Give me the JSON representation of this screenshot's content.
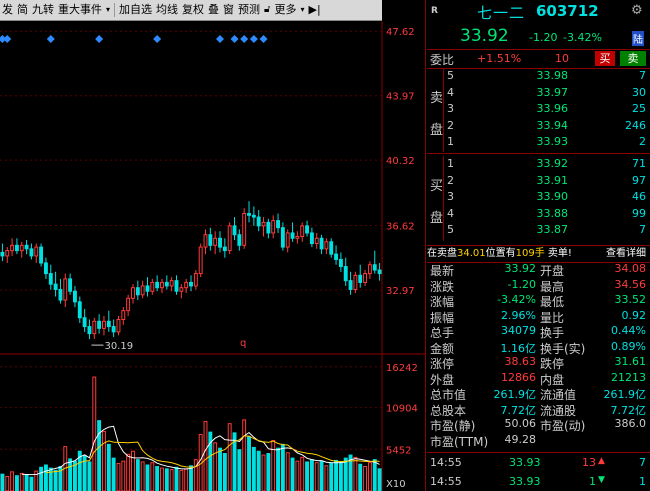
{
  "toolbar": {
    "items": [
      "发",
      "简",
      "九转",
      "重大事件",
      "加自选",
      "均线",
      "复权",
      "叠",
      "窗",
      "预测",
      "更多"
    ],
    "menu_arrow_label": "▾",
    "lock_icon": "lock-icon",
    "more_arrow": "▾",
    "export_label": "▶|"
  },
  "stock": {
    "name": "七一二",
    "code": "603712",
    "price": "33.92",
    "change": "-1.20",
    "change_pct": "-3.42%",
    "market_badge": "陆",
    "r_label": "R"
  },
  "ratio": {
    "label": "委比",
    "value": "+1.51%",
    "diff": "10",
    "buy_btn": "买",
    "sell_btn": "卖"
  },
  "sell_side_label": [
    "卖",
    "盘"
  ],
  "buy_side_label": [
    "买",
    "盘"
  ],
  "asks": [
    {
      "level": "5",
      "price": "33.98",
      "vol": "7"
    },
    {
      "level": "4",
      "price": "33.97",
      "vol": "30"
    },
    {
      "level": "3",
      "price": "33.96",
      "vol": "25"
    },
    {
      "level": "2",
      "price": "33.94",
      "vol": "246"
    },
    {
      "level": "1",
      "price": "33.93",
      "vol": "2"
    }
  ],
  "bids": [
    {
      "level": "1",
      "price": "33.92",
      "vol": "71"
    },
    {
      "level": "2",
      "price": "33.91",
      "vol": "97"
    },
    {
      "level": "3",
      "price": "33.90",
      "vol": "46"
    },
    {
      "level": "4",
      "price": "33.88",
      "vol": "99"
    },
    {
      "level": "5",
      "price": "33.87",
      "vol": "7"
    }
  ],
  "notice": {
    "prefix": "在卖盘",
    "price": "34.01",
    "mid": "位置有",
    "qty": "109手",
    "action": "卖单!",
    "link": "查看详细"
  },
  "stats": [
    {
      "k1": "最新",
      "v1": "33.92",
      "c1": "#00e676",
      "k2": "开盘",
      "v2": "34.08",
      "c2": "#ff3b3b"
    },
    {
      "k1": "涨跌",
      "v1": "-1.20",
      "c1": "#00e676",
      "k2": "最高",
      "v2": "34.56",
      "c2": "#ff3b3b"
    },
    {
      "k1": "涨幅",
      "v1": "-3.42%",
      "c1": "#00e676",
      "k2": "最低",
      "v2": "33.52",
      "c2": "#00e676"
    },
    {
      "k1": "振幅",
      "v1": "2.96%",
      "c1": "#00e0e0",
      "k2": "量比",
      "v2": "0.92",
      "c2": "#00e0e0"
    },
    {
      "k1": "总手",
      "v1": "34079",
      "c1": "#00e0e0",
      "k2": "换手",
      "v2": "0.44%",
      "c2": "#00e0e0"
    },
    {
      "k1": "金额",
      "v1": "1.16亿",
      "c1": "#00e0e0",
      "k2": "换手(实)",
      "v2": "0.89%",
      "c2": "#00e0e0"
    },
    {
      "k1": "涨停",
      "v1": "38.63",
      "c1": "#ff3b3b",
      "k2": "跌停",
      "v2": "31.61",
      "c2": "#00e676"
    },
    {
      "k1": "外盘",
      "v1": "12866",
      "c1": "#ff3b3b",
      "k2": "内盘",
      "v2": "21213",
      "c2": "#00e676"
    },
    {
      "k1": "总市值",
      "v1": "261.9亿",
      "c1": "#00e0e0",
      "k2": "流通值",
      "v2": "261.9亿",
      "c2": "#00e0e0"
    },
    {
      "k1": "总股本",
      "v1": "7.72亿",
      "c1": "#00e0e0",
      "k2": "流通股",
      "v2": "7.72亿",
      "c2": "#00e0e0"
    },
    {
      "k1": "市盈(静)",
      "v1": "50.06",
      "c1": "#ccc",
      "k2": "市盈(动)",
      "v2": "386.0",
      "c2": "#ccc"
    },
    {
      "k1": "市盈(TTM)",
      "v1": "49.28",
      "c1": "#ccc",
      "k2": "",
      "v2": "",
      "c2": "#ccc"
    }
  ],
  "ticks": [
    {
      "time": "14:55",
      "price": "33.93",
      "vol": "13",
      "dir": "up",
      "count": "7"
    },
    {
      "time": "14:55",
      "price": "33.93",
      "vol": "1",
      "dir": "down",
      "count": "1"
    }
  ],
  "colors": {
    "up": "#ff3b3b",
    "down": "#00e0e0",
    "border": "#8b0000",
    "axis_text": "#ff3b3b"
  },
  "chart_data": {
    "type": "candlestick",
    "price_axis_ticks": [
      "47.62",
      "43.97",
      "40.32",
      "36.62",
      "32.97"
    ],
    "volume_axis_ticks": [
      "16242",
      "10904",
      "5452"
    ],
    "volume_unit_label": "X10",
    "low_marker_label": "30.19",
    "q_marker": "q",
    "ylim": [
      29.8,
      48.2
    ],
    "vol_max": 17000,
    "candles": [
      {
        "o": 35.1,
        "h": 35.6,
        "l": 34.6,
        "c": 34.9,
        "v": 2200
      },
      {
        "o": 34.9,
        "h": 35.4,
        "l": 34.5,
        "c": 35.2,
        "v": 1900
      },
      {
        "o": 35.2,
        "h": 35.9,
        "l": 34.9,
        "c": 35.5,
        "v": 2500
      },
      {
        "o": 35.5,
        "h": 35.9,
        "l": 35.0,
        "c": 35.2,
        "v": 2000
      },
      {
        "o": 35.2,
        "h": 35.7,
        "l": 34.8,
        "c": 35.5,
        "v": 2300
      },
      {
        "o": 35.5,
        "h": 35.8,
        "l": 35.0,
        "c": 35.3,
        "v": 2100
      },
      {
        "o": 35.3,
        "h": 35.6,
        "l": 34.7,
        "c": 34.9,
        "v": 1800
      },
      {
        "o": 34.9,
        "h": 35.6,
        "l": 34.5,
        "c": 35.4,
        "v": 2600
      },
      {
        "o": 35.4,
        "h": 35.6,
        "l": 34.3,
        "c": 34.5,
        "v": 3100
      },
      {
        "o": 34.5,
        "h": 34.8,
        "l": 33.6,
        "c": 33.9,
        "v": 3400
      },
      {
        "o": 33.9,
        "h": 34.4,
        "l": 33.0,
        "c": 33.3,
        "v": 3000
      },
      {
        "o": 33.3,
        "h": 34.0,
        "l": 32.6,
        "c": 33.0,
        "v": 2700
      },
      {
        "o": 33.0,
        "h": 33.6,
        "l": 32.2,
        "c": 32.4,
        "v": 3200
      },
      {
        "o": 32.4,
        "h": 33.9,
        "l": 32.0,
        "c": 33.6,
        "v": 5800
      },
      {
        "o": 33.6,
        "h": 33.9,
        "l": 32.7,
        "c": 32.9,
        "v": 4200
      },
      {
        "o": 32.9,
        "h": 33.2,
        "l": 32.0,
        "c": 32.3,
        "v": 3900
      },
      {
        "o": 32.3,
        "h": 32.6,
        "l": 31.1,
        "c": 31.4,
        "v": 5200
      },
      {
        "o": 31.4,
        "h": 31.9,
        "l": 30.6,
        "c": 30.9,
        "v": 4600
      },
      {
        "o": 30.9,
        "h": 31.3,
        "l": 30.19,
        "c": 30.5,
        "v": 3800
      },
      {
        "o": 30.5,
        "h": 31.4,
        "l": 30.2,
        "c": 31.2,
        "v": 14900
      },
      {
        "o": 31.2,
        "h": 31.6,
        "l": 30.5,
        "c": 30.8,
        "v": 9200
      },
      {
        "o": 30.8,
        "h": 31.5,
        "l": 30.4,
        "c": 31.2,
        "v": 7800
      },
      {
        "o": 31.2,
        "h": 31.8,
        "l": 30.6,
        "c": 30.9,
        "v": 6100
      },
      {
        "o": 30.9,
        "h": 31.3,
        "l": 30.3,
        "c": 30.6,
        "v": 4300
      },
      {
        "o": 30.6,
        "h": 31.5,
        "l": 30.4,
        "c": 31.3,
        "v": 3600
      },
      {
        "o": 31.3,
        "h": 32.0,
        "l": 31.0,
        "c": 31.8,
        "v": 3900
      },
      {
        "o": 31.8,
        "h": 32.7,
        "l": 31.5,
        "c": 32.5,
        "v": 4800
      },
      {
        "o": 32.5,
        "h": 33.3,
        "l": 32.2,
        "c": 33.1,
        "v": 5200
      },
      {
        "o": 33.1,
        "h": 33.5,
        "l": 32.4,
        "c": 32.7,
        "v": 4100
      },
      {
        "o": 32.7,
        "h": 33.5,
        "l": 32.5,
        "c": 33.2,
        "v": 3800
      },
      {
        "o": 33.2,
        "h": 33.7,
        "l": 32.6,
        "c": 32.9,
        "v": 3400
      },
      {
        "o": 32.9,
        "h": 33.6,
        "l": 32.7,
        "c": 33.4,
        "v": 3700
      },
      {
        "o": 33.4,
        "h": 33.8,
        "l": 32.9,
        "c": 33.1,
        "v": 3200
      },
      {
        "o": 33.1,
        "h": 33.6,
        "l": 32.8,
        "c": 33.4,
        "v": 3000
      },
      {
        "o": 33.4,
        "h": 33.8,
        "l": 33.0,
        "c": 33.2,
        "v": 2900
      },
      {
        "o": 33.2,
        "h": 33.7,
        "l": 32.9,
        "c": 33.5,
        "v": 2800
      },
      {
        "o": 33.5,
        "h": 33.8,
        "l": 32.7,
        "c": 32.9,
        "v": 3100
      },
      {
        "o": 32.9,
        "h": 33.3,
        "l": 32.5,
        "c": 33.1,
        "v": 2700
      },
      {
        "o": 33.1,
        "h": 33.6,
        "l": 32.8,
        "c": 33.4,
        "v": 2900
      },
      {
        "o": 33.4,
        "h": 33.8,
        "l": 32.9,
        "c": 33.2,
        "v": 3300
      },
      {
        "o": 33.2,
        "h": 34.1,
        "l": 33.0,
        "c": 33.9,
        "v": 4100
      },
      {
        "o": 33.9,
        "h": 35.6,
        "l": 33.7,
        "c": 35.4,
        "v": 7400
      },
      {
        "o": 35.4,
        "h": 36.4,
        "l": 35.0,
        "c": 36.1,
        "v": 9100
      },
      {
        "o": 36.1,
        "h": 36.5,
        "l": 35.2,
        "c": 35.5,
        "v": 7700
      },
      {
        "o": 35.5,
        "h": 36.3,
        "l": 35.0,
        "c": 35.9,
        "v": 6300
      },
      {
        "o": 35.9,
        "h": 36.3,
        "l": 35.1,
        "c": 35.4,
        "v": 5600
      },
      {
        "o": 35.4,
        "h": 35.9,
        "l": 34.8,
        "c": 35.2,
        "v": 4900
      },
      {
        "o": 35.2,
        "h": 36.8,
        "l": 35.0,
        "c": 36.6,
        "v": 8800
      },
      {
        "o": 36.6,
        "h": 37.1,
        "l": 35.8,
        "c": 36.1,
        "v": 7600
      },
      {
        "o": 36.1,
        "h": 36.4,
        "l": 35.2,
        "c": 35.5,
        "v": 5400
      },
      {
        "o": 35.5,
        "h": 37.6,
        "l": 35.3,
        "c": 37.3,
        "v": 9300
      },
      {
        "o": 37.3,
        "h": 38.0,
        "l": 36.8,
        "c": 37.2,
        "v": 7100
      },
      {
        "o": 37.2,
        "h": 37.7,
        "l": 36.6,
        "c": 37.1,
        "v": 5700
      },
      {
        "o": 37.1,
        "h": 37.5,
        "l": 36.3,
        "c": 36.6,
        "v": 5200
      },
      {
        "o": 36.6,
        "h": 37.1,
        "l": 36.0,
        "c": 36.8,
        "v": 4700
      },
      {
        "o": 36.8,
        "h": 37.0,
        "l": 35.9,
        "c": 36.2,
        "v": 4900
      },
      {
        "o": 36.2,
        "h": 37.2,
        "l": 35.9,
        "c": 36.9,
        "v": 6600
      },
      {
        "o": 36.9,
        "h": 37.3,
        "l": 36.2,
        "c": 36.5,
        "v": 5600
      },
      {
        "o": 36.5,
        "h": 36.8,
        "l": 35.2,
        "c": 35.4,
        "v": 6100
      },
      {
        "o": 35.4,
        "h": 36.4,
        "l": 35.1,
        "c": 36.2,
        "v": 5000
      },
      {
        "o": 36.2,
        "h": 36.8,
        "l": 35.7,
        "c": 35.9,
        "v": 4300
      },
      {
        "o": 35.9,
        "h": 36.3,
        "l": 35.6,
        "c": 36.0,
        "v": 3900
      },
      {
        "o": 36.0,
        "h": 36.8,
        "l": 35.7,
        "c": 36.6,
        "v": 4400
      },
      {
        "o": 36.6,
        "h": 36.9,
        "l": 36.0,
        "c": 36.2,
        "v": 3800
      },
      {
        "o": 36.2,
        "h": 36.5,
        "l": 35.4,
        "c": 35.6,
        "v": 4100
      },
      {
        "o": 35.6,
        "h": 36.2,
        "l": 35.3,
        "c": 35.9,
        "v": 3700
      },
      {
        "o": 35.9,
        "h": 36.1,
        "l": 35.0,
        "c": 35.3,
        "v": 3900
      },
      {
        "o": 35.3,
        "h": 35.9,
        "l": 35.0,
        "c": 35.7,
        "v": 3300
      },
      {
        "o": 35.7,
        "h": 35.9,
        "l": 34.8,
        "c": 35.0,
        "v": 3600
      },
      {
        "o": 35.0,
        "h": 35.5,
        "l": 34.4,
        "c": 34.7,
        "v": 4000
      },
      {
        "o": 34.7,
        "h": 35.1,
        "l": 34.0,
        "c": 34.3,
        "v": 3800
      },
      {
        "o": 34.3,
        "h": 34.8,
        "l": 33.2,
        "c": 33.5,
        "v": 4300
      },
      {
        "o": 33.5,
        "h": 34.0,
        "l": 32.7,
        "c": 33.0,
        "v": 4700
      },
      {
        "o": 33.0,
        "h": 34.0,
        "l": 32.8,
        "c": 33.8,
        "v": 4400
      },
      {
        "o": 33.8,
        "h": 34.4,
        "l": 33.1,
        "c": 33.4,
        "v": 3500
      },
      {
        "o": 33.4,
        "h": 34.1,
        "l": 33.2,
        "c": 33.9,
        "v": 3200
      },
      {
        "o": 33.9,
        "h": 34.6,
        "l": 33.6,
        "c": 34.4,
        "v": 3700
      },
      {
        "o": 34.4,
        "h": 35.2,
        "l": 33.9,
        "c": 34.1,
        "v": 4100
      },
      {
        "o": 34.1,
        "h": 34.5,
        "l": 33.5,
        "c": 33.9,
        "v": 2900
      }
    ],
    "diamond_markers": [
      0,
      1,
      10,
      20,
      32,
      45,
      48,
      50,
      52,
      54
    ]
  }
}
